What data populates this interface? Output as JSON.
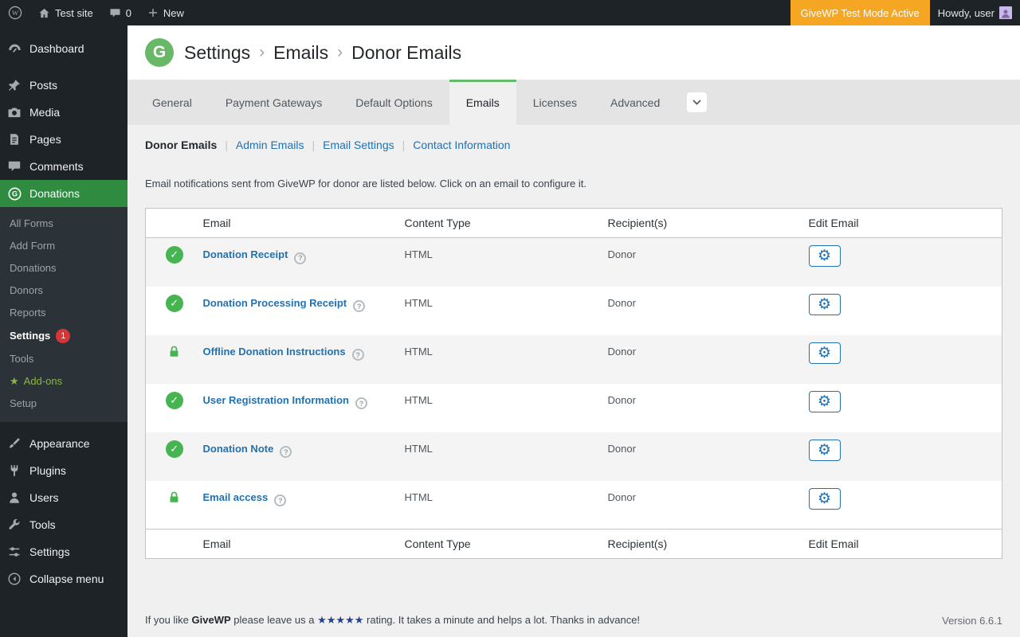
{
  "colors": {
    "accent_green": "#66bb6a",
    "active_menu_green": "#2e8b40",
    "link_blue": "#2271b1",
    "status_green": "#46b450",
    "test_mode_orange": "#f5a623",
    "badge_red": "#d63638"
  },
  "admin_bar": {
    "site_name": "Test site",
    "comments_count": "0",
    "new_label": "New",
    "test_mode_badge": "GiveWP Test Mode Active",
    "howdy_text": "Howdy, user"
  },
  "sidebar": {
    "items": [
      "Dashboard",
      "Posts",
      "Media",
      "Pages",
      "Comments",
      "Donations",
      "Appearance",
      "Plugins",
      "Users",
      "Tools",
      "Settings",
      "Collapse menu"
    ],
    "donations_submenu": [
      "All Forms",
      "Add Form",
      "Donations",
      "Donors",
      "Reports",
      "Settings",
      "Tools",
      "Add-ons",
      "Setup"
    ],
    "settings_badge": "1",
    "addons_star": "★"
  },
  "header": {
    "logo_letter": "G",
    "breadcrumb": [
      "Settings",
      "Emails",
      "Donor Emails"
    ]
  },
  "tabs": [
    "General",
    "Payment Gateways",
    "Default Options",
    "Emails",
    "Licenses",
    "Advanced"
  ],
  "subnav": [
    "Donor Emails",
    "Admin Emails",
    "Email Settings",
    "Contact Information"
  ],
  "description": "Email notifications sent from GiveWP for donor are listed below. Click on an email to configure it.",
  "table": {
    "columns": [
      "Email",
      "Content Type",
      "Recipient(s)",
      "Edit Email"
    ],
    "rows": [
      {
        "status": "enabled",
        "name": "Donation Receipt",
        "content_type": "HTML",
        "recipients": "Donor"
      },
      {
        "status": "enabled",
        "name": "Donation Processing Receipt",
        "content_type": "HTML",
        "recipients": "Donor"
      },
      {
        "status": "locked",
        "name": "Offline Donation Instructions",
        "content_type": "HTML",
        "recipients": "Donor"
      },
      {
        "status": "enabled",
        "name": "User Registration Information",
        "content_type": "HTML",
        "recipients": "Donor"
      },
      {
        "status": "enabled",
        "name": "Donation Note",
        "content_type": "HTML",
        "recipients": "Donor"
      },
      {
        "status": "locked",
        "name": "Email access",
        "content_type": "HTML",
        "recipients": "Donor"
      }
    ]
  },
  "footer": {
    "prefix": "If you like",
    "brand": "GiveWP",
    "middle": "please leave us a",
    "stars": "★★★★★",
    "suffix": "rating. It takes a minute and helps a lot. Thanks in advance!",
    "version": "Version 6.6.1"
  }
}
